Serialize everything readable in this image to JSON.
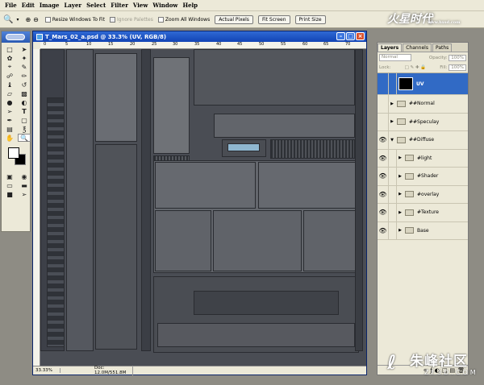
{
  "menu": [
    "File",
    "Edit",
    "Image",
    "Layer",
    "Select",
    "Filter",
    "View",
    "Window",
    "Help"
  ],
  "options": {
    "resize": "Resize Windows To Fit",
    "ignore": "Ignore Palettes",
    "zoomall": "Zoom All Windows",
    "actual": "Actual Pixels",
    "fit": "Fit Screen",
    "print": "Print Size"
  },
  "logo": {
    "main": "火星时代",
    "sub": "www.hxsd.com"
  },
  "document": {
    "title": "T_Mars_02_a.psd @ 33.3% (UV, RGB/8)",
    "ruler": [
      "0",
      "5",
      "10",
      "15",
      "20",
      "25",
      "30",
      "35",
      "40",
      "45",
      "50",
      "55",
      "60",
      "65",
      "70"
    ],
    "zoom": "33.33%",
    "docsize": "Doc: 12.0M/551.8M"
  },
  "layers": {
    "tabs": [
      "Layers",
      "Channels",
      "Paths"
    ],
    "blend": "Normal",
    "opacity_label": "Opacity:",
    "opacity": "100%",
    "lock_label": "Lock:",
    "fill_label": "Fill:",
    "fill": "100%",
    "rows": [
      "UV",
      "##Normal",
      "##Speculay",
      "##Diffuse",
      "#light",
      "#Shader",
      "#overlay",
      "#Texture",
      "Base"
    ]
  },
  "watermark": {
    "main": "朱峰社区",
    "sub": "ZF3D.COM"
  }
}
